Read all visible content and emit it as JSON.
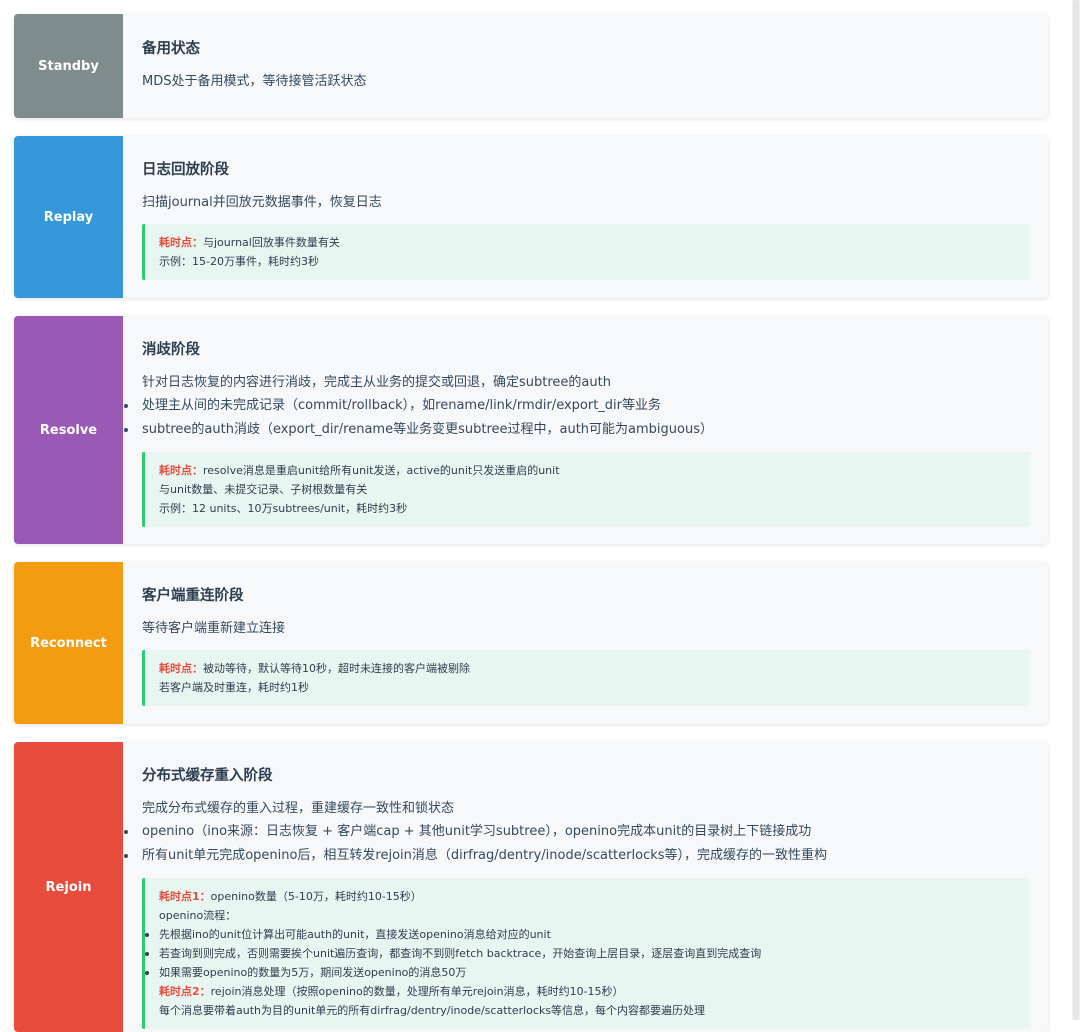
{
  "phases": [
    {
      "label": "Standby",
      "color": "#7f8c8d",
      "title": "备用状态",
      "desc": "MDS处于备用模式，等待接管活跃状态"
    },
    {
      "label": "Replay",
      "color": "#3498db",
      "title": "日志回放阶段",
      "desc": "扫描journal并回放元数据事件，恢复日志",
      "note": {
        "key": "耗时点：",
        "key_text": "与journal回放事件数量有关",
        "lines": [
          "示例：15-20万事件，耗时约3秒"
        ]
      }
    },
    {
      "label": "Resolve",
      "color": "#9b59b6",
      "title": "消歧阶段",
      "desc": "针对日志恢复的内容进行消歧，完成主从业务的提交或回退，确定subtree的auth",
      "bullets": [
        "处理主从间的未完成记录（commit/rollback），如rename/link/rmdir/export_dir等业务",
        "subtree的auth消歧（export_dir/rename等业务变更subtree过程中，auth可能为ambiguous）"
      ],
      "note": {
        "key": "耗时点：",
        "key_text": "resolve消息是重启unit给所有unit发送，active的unit只发送重启的unit",
        "lines": [
          "与unit数量、未提交记录、子树根数量有关",
          "示例：12 units、10万subtrees/unit，耗时约3秒"
        ]
      }
    },
    {
      "label": "Reconnect",
      "color": "#f39c12",
      "title": "客户端重连阶段",
      "desc": "等待客户端重新建立连接",
      "note": {
        "key": "耗时点：",
        "key_text": "被动等待，默认等待10秒，超时未连接的客户端被剔除",
        "lines": [
          "若客户端及时重连，耗时约1秒"
        ]
      }
    },
    {
      "label": "Rejoin",
      "color": "#e74c3c",
      "title": "分布式缓存重入阶段",
      "desc": "完成分布式缓存的重入过程，重建缓存一致性和锁状态",
      "bullets": [
        "openino（ino来源：日志恢复 + 客户端cap + 其他unit学习subtree），openino完成本unit的目录树上下链接成功",
        "所有unit单元完成openino后，相互转发rejoin消息（dirfrag/dentry/inode/scatterlocks等），完成缓存的一致性重构"
      ],
      "note": {
        "key": "耗时点1：",
        "key_text": "openino数量（5-10万，耗时约10-15秒）",
        "lines": [
          "openino流程："
        ],
        "bullets": [
          "先根据ino的unit位计算出可能auth的unit，直接发送openino消息给对应的unit",
          "若查询到则完成，否则需要挨个unit遍历查询，都查询不到则fetch backtrace，开始查询上层目录，逐层查询直到完成查询",
          "如果需要openino的数量为5万，期间发送openino的消息50万"
        ],
        "key2": "耗时点2：",
        "key2_text": "rejoin消息处理（按照openino的数量，处理所有单元rejoin消息，耗时约10-15秒）",
        "tail": "每个消息要带着auth为目的unit单元的所有dirfrag/dentry/inode/scatterlocks等信息，每个内容都要遍历处理"
      }
    }
  ]
}
